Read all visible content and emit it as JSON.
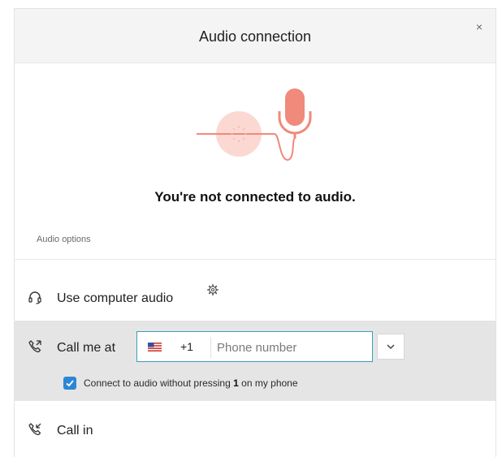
{
  "dialog": {
    "title": "Audio connection",
    "close_label": "×"
  },
  "illustration": {
    "accent_color": "#f08a7a",
    "soft_color": "#fbd9d2",
    "icon": "microphone-icon"
  },
  "status_text": "You're not connected to audio.",
  "options_label": "Audio options",
  "options": {
    "computer_audio": {
      "label": "Use computer audio",
      "icon": "headset-icon",
      "settings_icon": "gear-icon"
    },
    "call_me": {
      "label": "Call me at",
      "icon": "phone-outgoing-icon",
      "country_flag": "us-flag-icon",
      "dial_code": "+1",
      "phone_value": "",
      "phone_placeholder": "Phone number",
      "dropdown_icon": "chevron-down-icon",
      "auto_connect_checked": true,
      "auto_connect_text_before": "Connect to audio without pressing ",
      "auto_connect_key": "1",
      "auto_connect_text_after": " on my phone"
    },
    "call_in": {
      "label": "Call in",
      "icon": "phone-incoming-icon"
    }
  },
  "colors": {
    "accent_blue": "#2b86d6",
    "focus_border": "#3a9fb7",
    "selected_row": "#e5e5e5",
    "header_bg": "#f4f4f4"
  }
}
